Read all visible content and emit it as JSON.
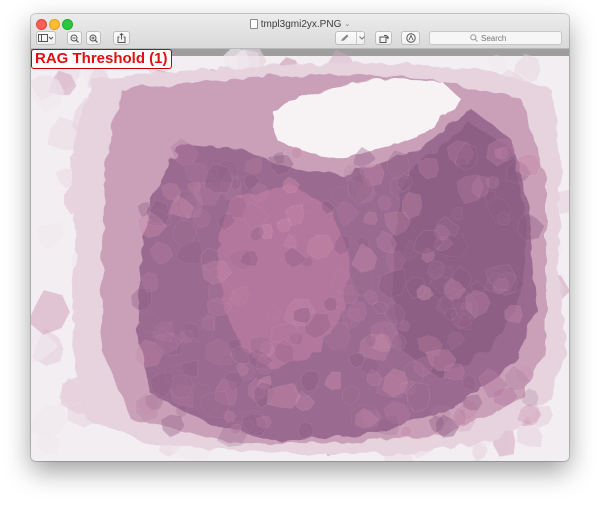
{
  "window": {
    "title": "tmpl3gmi2yx.PNG",
    "icons": {
      "close": "close-circle",
      "minimize": "minimize-circle",
      "zoom": "zoom-circle",
      "sidebar": "sidebar-icon",
      "zoom_out": "zoom-out-icon",
      "zoom_in": "zoom-in-icon",
      "share": "share-icon",
      "markup": "pen-icon",
      "rotate": "rotate-icon",
      "annotate": "annotate-icon"
    },
    "search": {
      "placeholder": "Search"
    }
  },
  "image": {
    "label": "RAG Threshold (1)",
    "label_color": "#e01010",
    "palette": [
      "#9a6a8f",
      "#b57a9f",
      "#c98bab",
      "#8d5d84",
      "#d4a8c0",
      "#e7d2de",
      "#f0e9ee",
      "#ffffff"
    ]
  }
}
